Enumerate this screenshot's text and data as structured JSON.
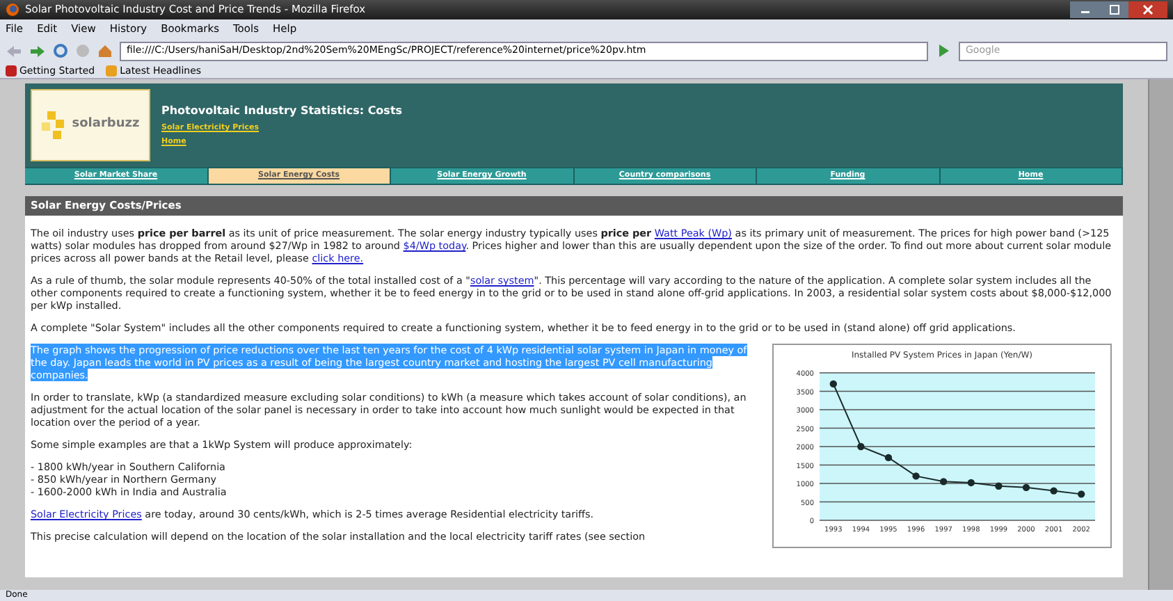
{
  "window": {
    "title": "Solar Photovoltaic Industry Cost and Price Trends - Mozilla Firefox"
  },
  "menu": [
    "File",
    "Edit",
    "View",
    "History",
    "Bookmarks",
    "Tools",
    "Help"
  ],
  "address": {
    "value": "file:///C:/Users/haniSaH/Desktop/2nd%20Sem%20MEngSc/PROJECT/reference%20internet/price%20pv.htm"
  },
  "search": {
    "placeholder": "Google"
  },
  "bookmarks": [
    "Getting Started",
    "Latest Headlines"
  ],
  "site": {
    "logo": "solarbuzz",
    "title": "Photovoltaic Industry Statistics: Costs",
    "links": [
      "Solar Electricity Prices",
      "Home"
    ]
  },
  "tabs": [
    {
      "label": "Solar Market Share",
      "selected": false
    },
    {
      "label": "Solar Energy Costs",
      "selected": true
    },
    {
      "label": "Solar Energy Growth",
      "selected": false
    },
    {
      "label": "Country comparisons",
      "selected": false
    },
    {
      "label": "Funding",
      "selected": false
    },
    {
      "label": "Home",
      "selected": false
    }
  ],
  "section": {
    "heading": "Solar Energy Costs/Prices"
  },
  "paragraphs": [
    {
      "selected": false,
      "parts": [
        {
          "kind": "text",
          "text": "The oil industry uses **price per barrel** as its unit of price measurement. The solar energy industry typically uses **price per** "
        },
        {
          "kind": "link",
          "text": "Watt Peak (Wp)"
        },
        {
          "kind": "text",
          "text": " as its primary unit of measurement.  The prices for high power band (>125 watts) solar modules has dropped from around $27/Wp in 1982 to around "
        },
        {
          "kind": "link",
          "text": "$4/Wp today"
        },
        {
          "kind": "text",
          "text": ".  Prices higher and lower than this are usually dependent upon the size of the order. To find out more about current solar module prices across all power bands at the Retail level, please "
        },
        {
          "kind": "link",
          "text": "click here."
        }
      ]
    },
    {
      "selected": false,
      "parts": [
        {
          "kind": "text",
          "text": "As a rule of thumb, the solar module represents 40-50% of the total installed cost of a \""
        },
        {
          "kind": "link",
          "text": "solar system"
        },
        {
          "kind": "text",
          "text": "\". This percentage will vary according to the nature of the application.  A complete solar system includes all the other components required to create a functioning system, whether it be to feed energy in to the grid or to be used in stand alone off-grid applications. In 2003, a residential solar system costs about $8,000-$12,000 per kWp installed."
        }
      ]
    },
    {
      "selected": false,
      "parts": [
        {
          "kind": "text",
          "text": "A complete \"Solar System\" includes all the other components required to create a functioning system, whether it be to feed energy in to the grid or to be used in (stand alone) off grid applications."
        }
      ]
    },
    {
      "selected": true,
      "parts": [
        {
          "kind": "text",
          "text": "The graph shows the progression of price reductions over the last ten years for the cost of 4 kWp residential solar system in Japan in money of the day. Japan leads the world in PV prices as a result of being the largest country market and hosting the largest PV cell manufacturing companies."
        }
      ]
    },
    {
      "selected": false,
      "parts": [
        {
          "kind": "text",
          "text": "In order to translate, kWp (a standardized measure excluding solar conditions) to kWh (a measure which takes account of solar conditions), an adjustment for the actual location of the solar panel is necessary in order to take into account how much sunlight would be expected in that location over the period of a year."
        }
      ]
    },
    {
      "selected": false,
      "parts": [
        {
          "kind": "text",
          "text": "Some simple examples are that a 1kWp System will produce approximately:"
        }
      ]
    },
    {
      "selected": false,
      "lines": [
        "- 1800 kWh/year in Southern California",
        "- 850 kWh/year in Northern Germany",
        "- 1600-2000 kWh in India and Australia"
      ]
    },
    {
      "selected": false,
      "parts": [
        {
          "kind": "link",
          "text": "Solar Electricity Prices"
        },
        {
          "kind": "text",
          "text": " are today, around 30 cents/kWh, which is 2-5 times average Residential electricity tariffs."
        }
      ]
    },
    {
      "selected": false,
      "parts": [
        {
          "kind": "text",
          "text": "This precise calculation will depend on the location of the solar installation and the local electricity tariff rates (see section"
        }
      ]
    }
  ],
  "chart": {
    "chart_data": {
      "type": "line",
      "title": "Installed PV System Prices in Japan (Yen/W)",
      "categories": [
        "1993",
        "1994",
        "1995",
        "1996",
        "1997",
        "1998",
        "1999",
        "2000",
        "2001",
        "2002"
      ],
      "series": [
        {
          "color": "#1a2a2a",
          "marker": true,
          "values": [
            3700,
            2000,
            1700,
            1200,
            1050,
            1020,
            930,
            890,
            800,
            710
          ]
        }
      ],
      "grid": true,
      "ylim": [
        0,
        4000
      ],
      "yticks": [
        0,
        500,
        1000,
        1500,
        2000,
        2500,
        3000,
        3500,
        4000
      ]
    }
  },
  "status_bar": {
    "text": "Done"
  }
}
